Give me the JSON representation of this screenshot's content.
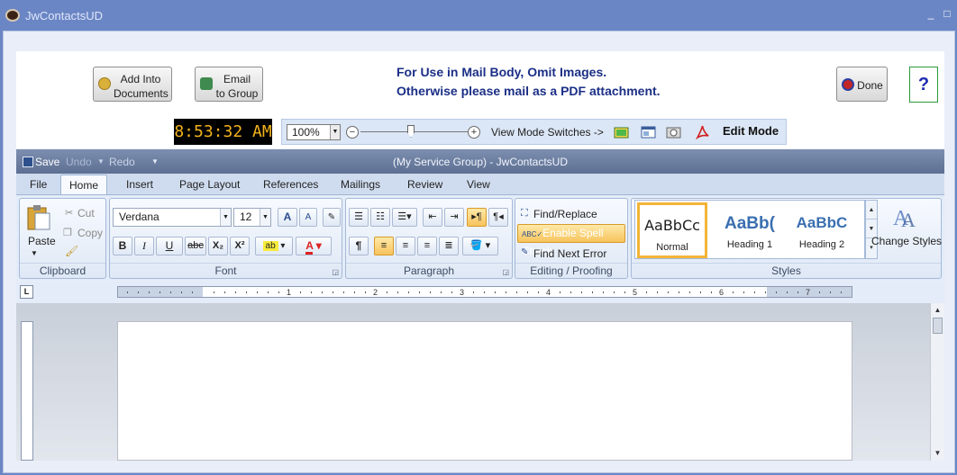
{
  "window": {
    "title": "JwContactsUD",
    "minimize": "_",
    "maximize": "□"
  },
  "actions": {
    "add_into_documents": "Add Into\nDocuments",
    "email_to_group": "Email\nto Group",
    "done": "Done",
    "help": "?"
  },
  "notice": {
    "line1": "For Use in Mail Body, Omit Images.",
    "line2": "Otherwise please mail as a PDF attachment."
  },
  "clock": "8:53:32 AM",
  "zoom": {
    "value": "100%",
    "minus": "−",
    "plus": "+",
    "level": 0.5
  },
  "view_mode": {
    "label": "View Mode Switches ->",
    "mode": "Edit Mode",
    "icons": [
      "print-layout-icon",
      "web-layout-icon",
      "read-mode-icon",
      "pdf-icon"
    ]
  },
  "quick_access": {
    "save": "Save",
    "undo": "Undo",
    "redo": "Redo",
    "caption": "(My Service Group)  - JwContactsUD"
  },
  "tabs": [
    "File",
    "Home",
    "Insert",
    "Page Layout",
    "References",
    "Mailings",
    "Review",
    "View"
  ],
  "active_tab": "Home",
  "ribbon": {
    "clipboard": {
      "label": "Clipboard",
      "paste": "Paste",
      "cut": "Cut",
      "copy": "Copy"
    },
    "font": {
      "label": "Font",
      "family": "Verdana",
      "size": "12",
      "bold": "B",
      "italic": "I",
      "underline": "U",
      "strike": "abc",
      "subscript": "X₂",
      "superscript": "X²"
    },
    "paragraph": {
      "label": "Paragraph",
      "pilcrow": "¶"
    },
    "editing": {
      "label": "Editing / Proofing",
      "find_replace": "Find/Replace",
      "spell_check": "Enable Spell Check",
      "find_next": "Find Next Error"
    },
    "styles": {
      "label": "Styles",
      "items": [
        {
          "sample": "AaBbCc",
          "name": "Normal"
        },
        {
          "sample": "AaBb(",
          "name": "Heading 1"
        },
        {
          "sample": "AaBbC",
          "name": "Heading 2"
        }
      ],
      "change_styles": "Change Styles"
    }
  },
  "ruler": {
    "numbers": [
      "1",
      "2",
      "3",
      "4",
      "5",
      "6",
      "7"
    ]
  },
  "colors": {
    "accent": "#1b2f86",
    "title_bar": "#6b86c4",
    "clock_text": "#f2b21c",
    "style_selected": "#f2b437"
  }
}
